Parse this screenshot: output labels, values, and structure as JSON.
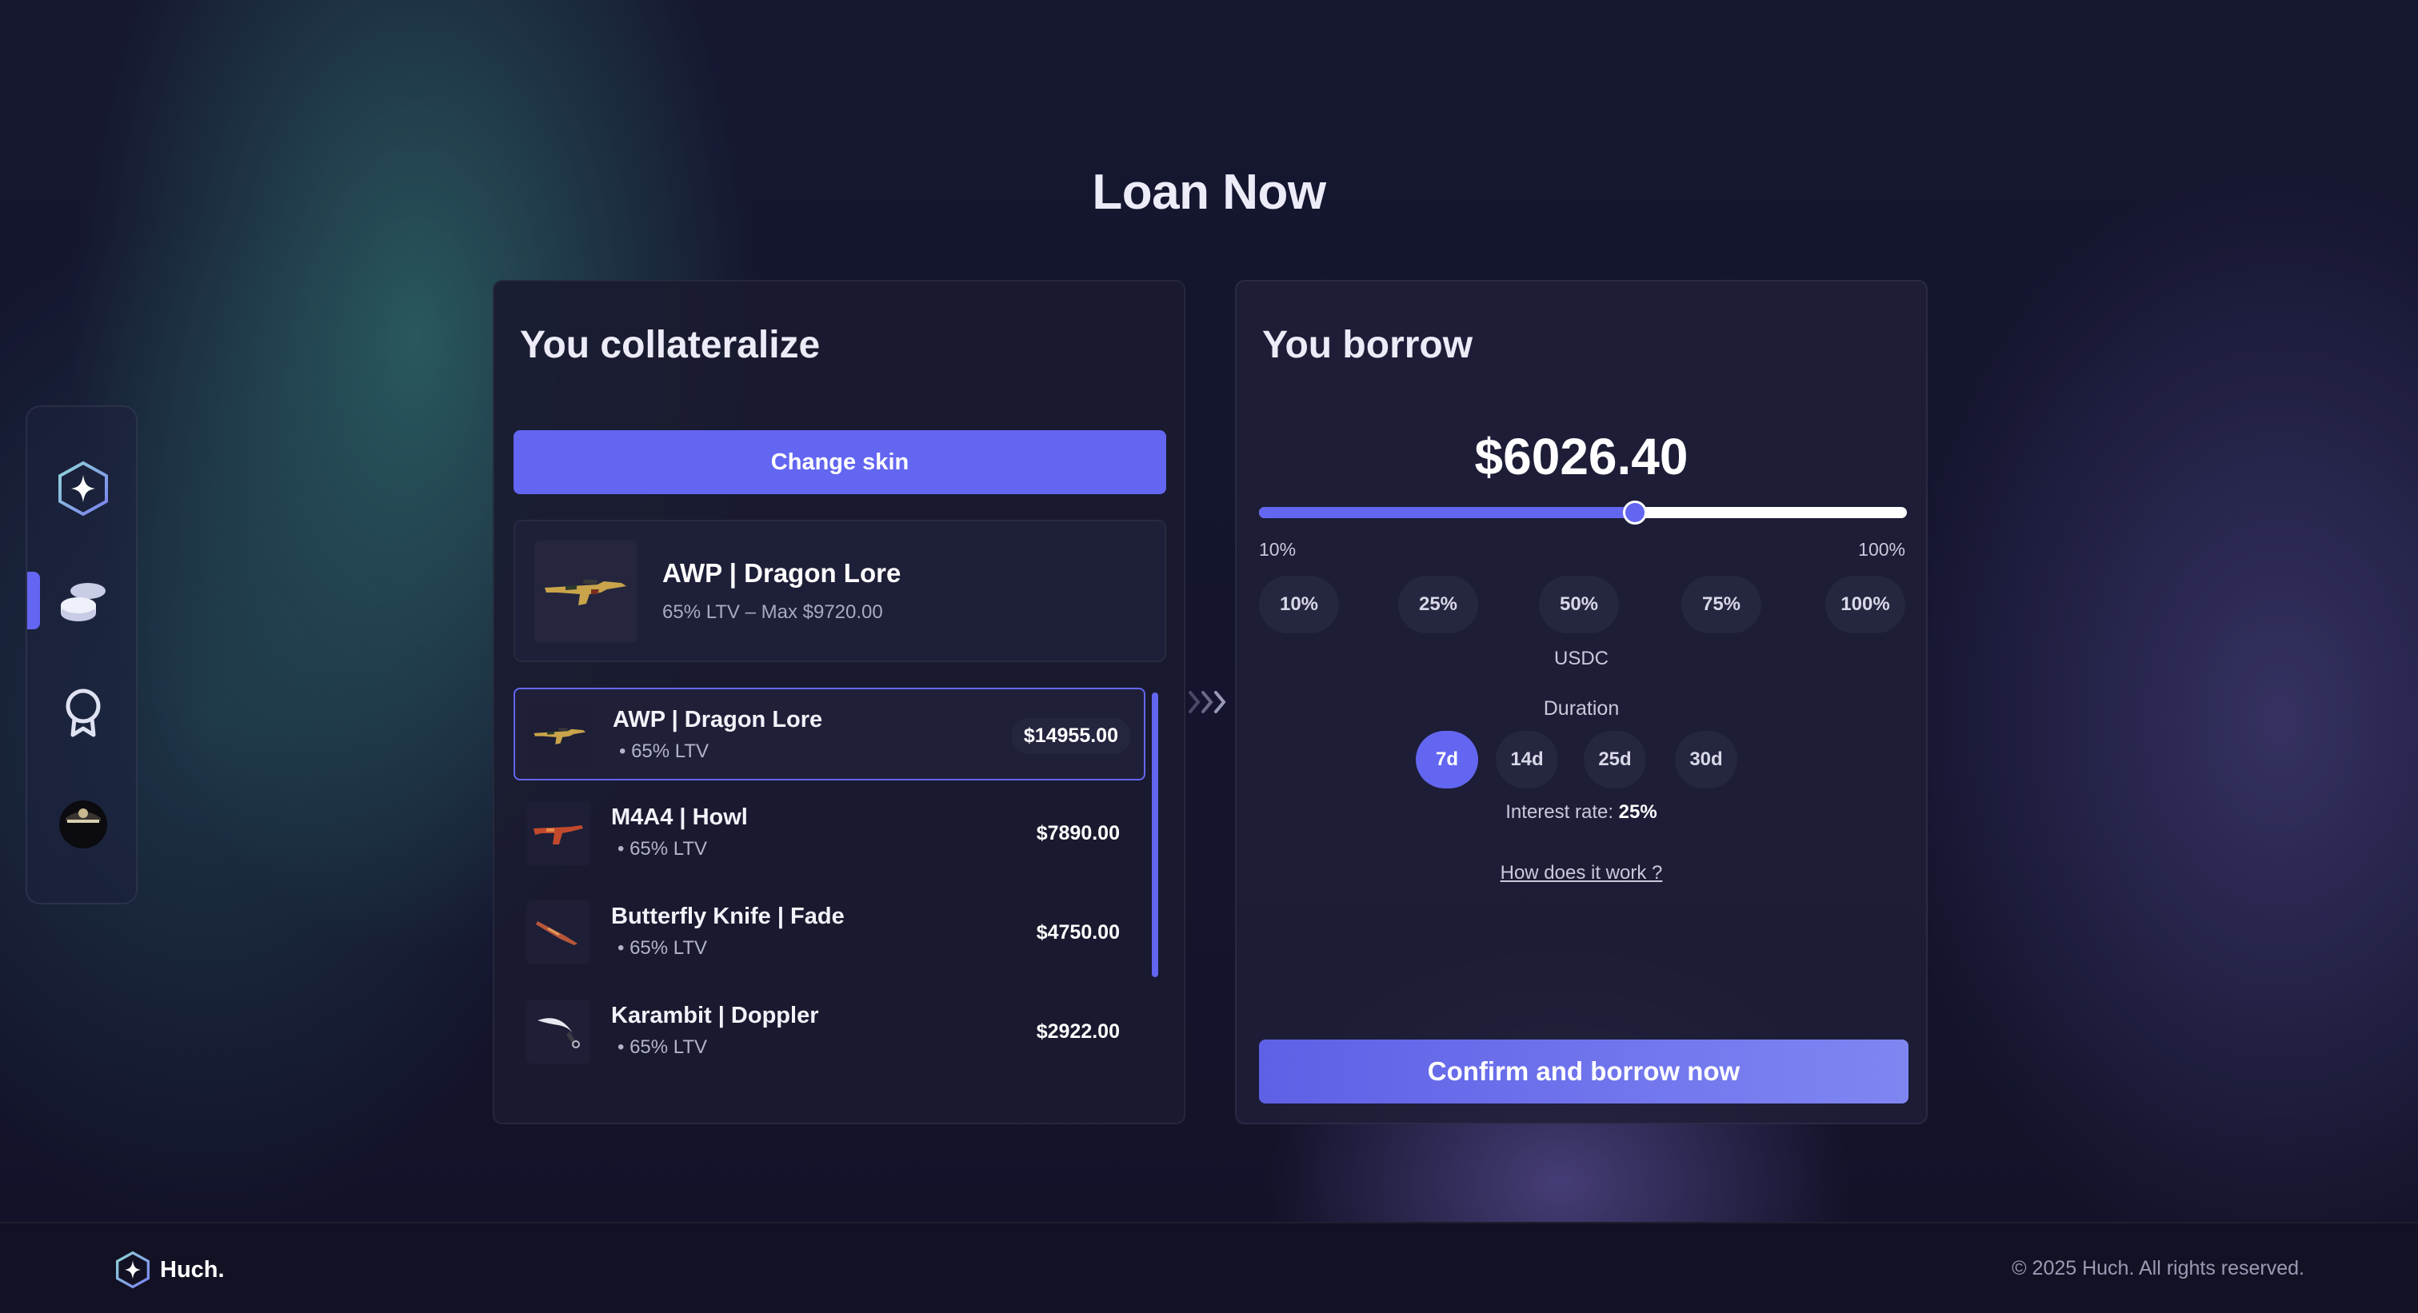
{
  "page": {
    "title": "Loan Now"
  },
  "sidebar": {
    "items": [
      {
        "name": "hex-star-icon"
      },
      {
        "name": "coins-icon",
        "active": true
      },
      {
        "name": "award-icon"
      },
      {
        "name": "avatar"
      }
    ]
  },
  "collateral": {
    "title": "You collateralize",
    "change_label": "Change skin",
    "selected": {
      "name": "AWP | Dragon Lore",
      "subtitle": "65% LTV – Max $9720.00"
    },
    "items": [
      {
        "name": "AWP | Dragon Lore",
        "ltv": "• 65% LTV",
        "price": "$14955.00",
        "selected": true
      },
      {
        "name": "M4A4 | Howl",
        "ltv": "• 65% LTV",
        "price": "$7890.00"
      },
      {
        "name": "Butterfly Knife | Fade",
        "ltv": "• 65% LTV",
        "price": "$4750.00"
      },
      {
        "name": "Karambit | Doppler",
        "ltv": "• 65% LTV",
        "price": "$2922.00"
      }
    ]
  },
  "borrow": {
    "title": "You borrow",
    "amount": "$6026.40",
    "slider": {
      "min_label": "10%",
      "max_label": "100%",
      "value_fraction": 0.58
    },
    "percent_options": [
      "10%",
      "25%",
      "50%",
      "75%",
      "100%"
    ],
    "currency": "USDC",
    "duration_label": "Duration",
    "durations": [
      "7d",
      "14d",
      "25d",
      "30d"
    ],
    "selected_duration": "7d",
    "interest_label": "Interest rate:",
    "interest_value": "25%",
    "how_link": "How does it work ?",
    "confirm_label": "Confirm and borrow now"
  },
  "footer": {
    "brand": "Huch.",
    "copyright": "© 2025 Huch. All rights reserved."
  },
  "colors": {
    "accent": "#6366f1",
    "background": "#141430"
  }
}
